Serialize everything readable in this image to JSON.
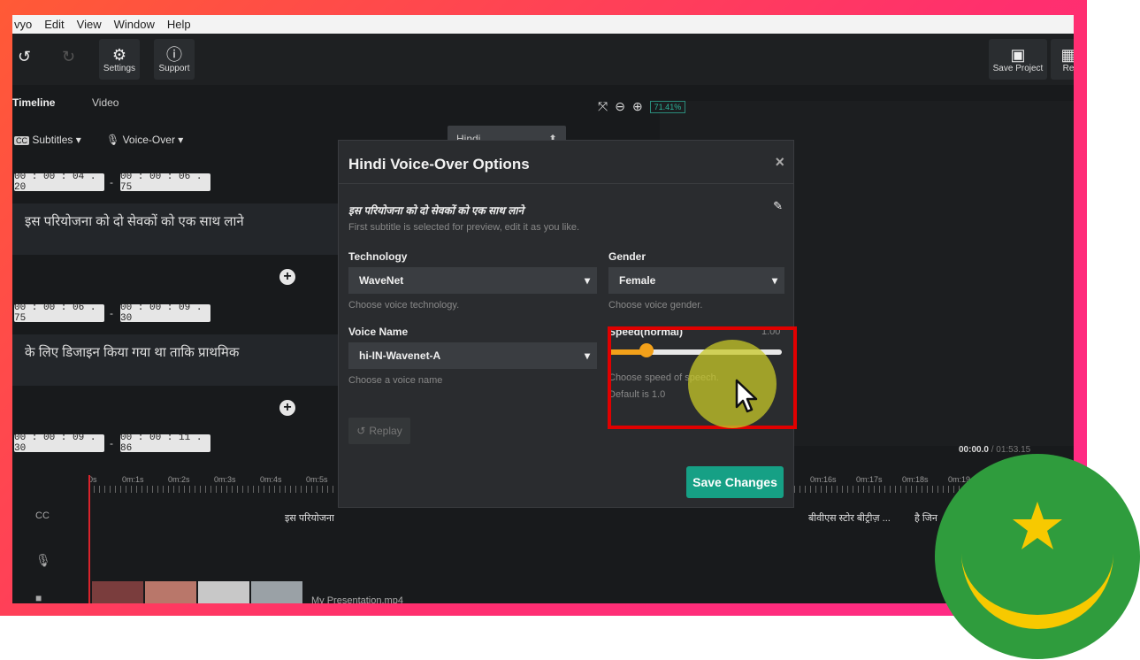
{
  "menu": [
    "vyo",
    "Edit",
    "View",
    "Window",
    "Help"
  ],
  "toolbar": {
    "settings_label": "Settings",
    "support_label": "Support",
    "save_project_label": "Save Project",
    "re_label": "Re"
  },
  "tabs": [
    "Timeline",
    "Video"
  ],
  "subtitles_dropdown": "Subtitles",
  "voiceover_dropdown": "Voice-Over",
  "language_select": "Hindi",
  "zoom_value": "71.41%",
  "segments": [
    {
      "start": "00 : 00 : 04 . 20",
      "end": "00 : 00 : 06 . 75",
      "text": "इस परियोजना को दो सेवकों को एक साथ लाने"
    },
    {
      "start": "00 : 00 : 06 . 75",
      "end": "00 : 00 : 09 . 30",
      "text": "के लिए डिजाइन किया गया था ताकि प्राथमिक"
    },
    {
      "start": "00 : 00 : 09 . 30",
      "end": "00 : 00 : 11 . 86",
      "text": ""
    }
  ],
  "time_separator": "-",
  "ruler_ticks": [
    "0s",
    "0m:1s",
    "0m:2s",
    "0m:3s",
    "0m:4s",
    "0m:5s",
    "0m:16s",
    "0m:17s",
    "0m:18s",
    "0m:19"
  ],
  "time_current": "00:00.0",
  "time_total": "/ 01:53.15",
  "timeline_track_text": [
    "इस परियोजना",
    "बीवीएस स्टोर बीट्रीज़ ...",
    "है जिन"
  ],
  "video_clip_name": "My Presentation.mp4",
  "modal": {
    "title": "Hindi Voice-Over Options",
    "close": "×",
    "preview_text": "इस परियोजना को दो सेवकों को एक साथ लाने",
    "preview_help": "First subtitle is selected for preview, edit it as you like.",
    "technology_label": "Technology",
    "technology_value": "WaveNet",
    "technology_help": "Choose voice technology.",
    "gender_label": "Gender",
    "gender_value": "Female",
    "gender_help": "Choose voice gender.",
    "voice_name_label": "Voice Name",
    "voice_name_value": "hi-IN-Wavenet-A",
    "voice_name_help": "Choose a voice name",
    "speed_label": "Speed(normal)",
    "speed_value_text": "1.00",
    "speed_level": 0.22,
    "speed_help_1": "Choose speed of speech.",
    "speed_help_2": "Default is 1.0",
    "replay_label": "Replay",
    "save_label": "Save Changes"
  },
  "colors": {
    "accent_green": "#16a085",
    "slider_orange": "#f3a11a",
    "highlight_red": "#e00000",
    "flag_green": "#2f9c3d",
    "flag_gold": "#f7c900"
  }
}
